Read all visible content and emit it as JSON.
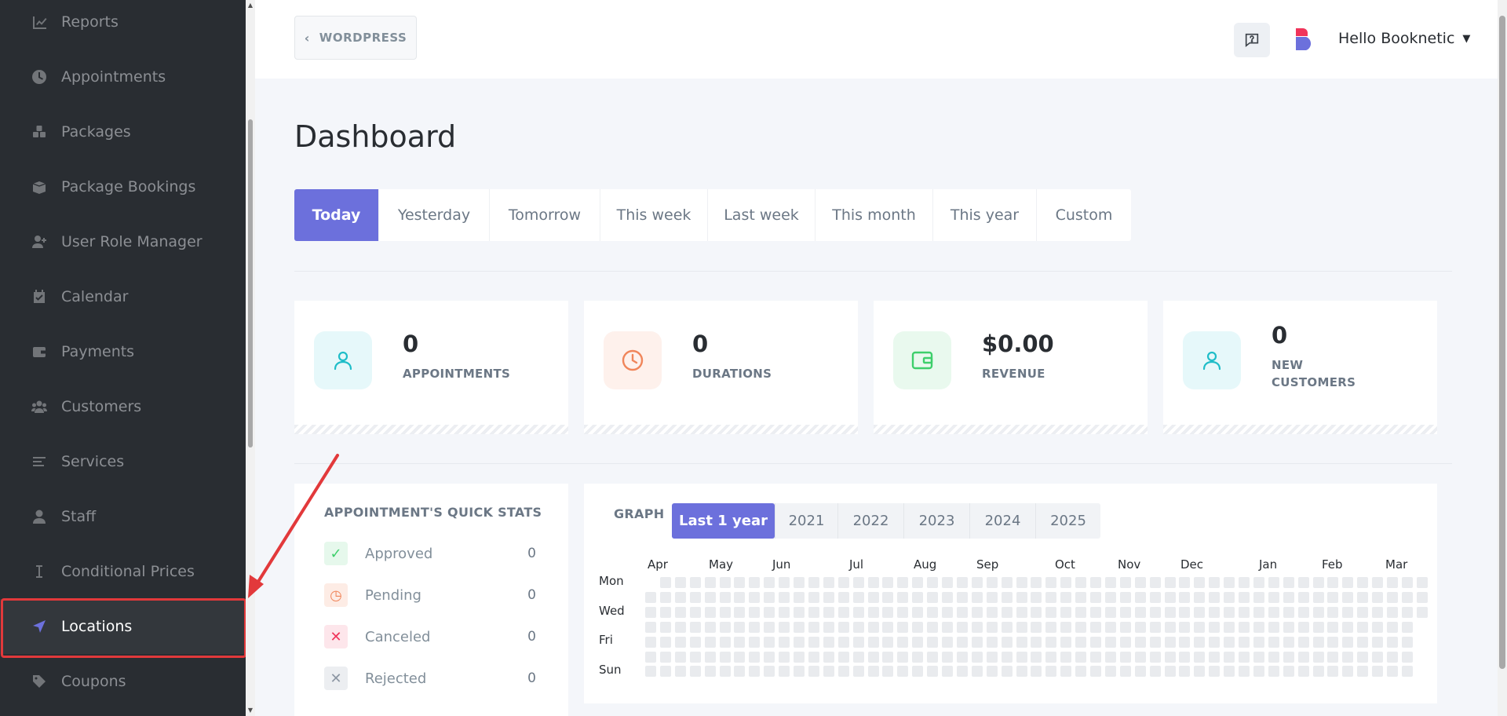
{
  "sidebar": {
    "items": [
      {
        "label": "Reports",
        "icon": "chart-line-icon"
      },
      {
        "label": "Appointments",
        "icon": "clock-icon"
      },
      {
        "label": "Packages",
        "icon": "boxes-icon"
      },
      {
        "label": "Package Bookings",
        "icon": "box-open-icon"
      },
      {
        "label": "User Role Manager",
        "icon": "user-plus-icon"
      },
      {
        "label": "Calendar",
        "icon": "calendar-check-icon"
      },
      {
        "label": "Payments",
        "icon": "wallet-icon"
      },
      {
        "label": "Customers",
        "icon": "users-icon"
      },
      {
        "label": "Services",
        "icon": "list-icon"
      },
      {
        "label": "Staff",
        "icon": "user-icon"
      },
      {
        "label": "Conditional Prices",
        "icon": "i-cursor-icon"
      },
      {
        "label": "Locations",
        "icon": "location-arrow-icon",
        "active": true
      },
      {
        "label": "Coupons",
        "icon": "tag-icon"
      }
    ]
  },
  "topbar": {
    "back_label": "WORDPRESS",
    "user_greeting": "Hello Booknetic"
  },
  "page": {
    "title": "Dashboard"
  },
  "date_tabs": [
    "Today",
    "Yesterday",
    "Tomorrow",
    "This week",
    "Last week",
    "This month",
    "This year",
    "Custom"
  ],
  "active_date_tab": "Today",
  "stats": [
    {
      "value": "0",
      "label": "APPOINTMENTS",
      "icon": "user-icon",
      "color": "#1fbdc8",
      "bg": "#e6f8fa"
    },
    {
      "value": "0",
      "label": "DURATIONS",
      "icon": "clock-icon",
      "color": "#f0855a",
      "bg": "#fef1ec"
    },
    {
      "value": "$0.00",
      "label": "REVENUE",
      "icon": "wallet-icon",
      "color": "#3ecf6b",
      "bg": "#e9f9ee"
    },
    {
      "value": "0",
      "label": "NEW CUSTOMERS",
      "label_line1": "NEW",
      "label_line2": "CUSTOMERS",
      "icon": "user-icon",
      "color": "#1fbdc8",
      "bg": "#e6f8fa"
    }
  ],
  "quick_stats": {
    "title": "APPOINTMENT'S QUICK STATS",
    "rows": [
      {
        "label": "Approved",
        "count": "0",
        "icon": "check-icon",
        "color": "#3ecf6b",
        "bg": "#e6f8ec"
      },
      {
        "label": "Pending",
        "count": "0",
        "icon": "clock-icon",
        "color": "#f0855a",
        "bg": "#fdece5"
      },
      {
        "label": "Canceled",
        "count": "0",
        "icon": "x-icon",
        "color": "#f0345a",
        "bg": "#fde6eb"
      },
      {
        "label": "Rejected",
        "count": "0",
        "icon": "x-icon",
        "color": "#8c96a3",
        "bg": "#eceef1"
      }
    ]
  },
  "graph": {
    "title": "GRAPH",
    "year_tabs": [
      "Last 1 year",
      "2021",
      "2022",
      "2023",
      "2024",
      "2025"
    ],
    "active_year_tab": "Last 1 year",
    "months": [
      "Apr",
      "May",
      "Jun",
      "Jul",
      "Aug",
      "Sep",
      "Oct",
      "Nov",
      "Dec",
      "Jan",
      "Feb",
      "Mar"
    ],
    "days": [
      "Mon",
      "Wed",
      "Fri",
      "Sun"
    ]
  },
  "colors": {
    "accent": "#6c70dc",
    "sidebar_bg": "#292d32",
    "highlight_red": "#e2393b"
  }
}
